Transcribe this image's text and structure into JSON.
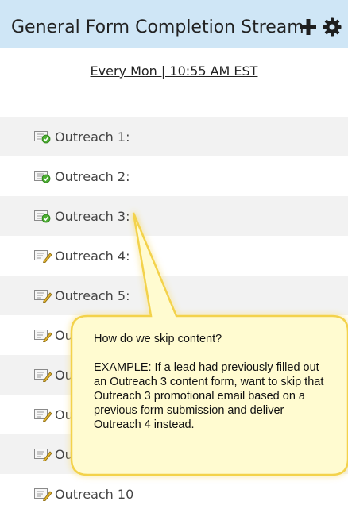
{
  "header": {
    "title": "General Form Completion Stream",
    "add_icon": "plus-icon",
    "settings_icon": "gear-icon",
    "color": "#cfe6f6"
  },
  "schedule": "Every Mon | 10:55 AM EST",
  "rows": [
    {
      "label": "Outreach 1:",
      "icon": "email-checked-icon"
    },
    {
      "label": "Outreach 2:",
      "icon": "email-checked-icon"
    },
    {
      "label": "Outreach 3:",
      "icon": "email-checked-icon"
    },
    {
      "label": "Outreach 4:",
      "icon": "email-edit-icon"
    },
    {
      "label": "Outreach 5:",
      "icon": "email-edit-icon"
    },
    {
      "label": "Out",
      "icon": "email-edit-icon"
    },
    {
      "label": "Ou",
      "icon": "email-edit-icon"
    },
    {
      "label": "Ou",
      "icon": "email-edit-icon"
    },
    {
      "label": "Ou",
      "icon": "email-edit-icon"
    },
    {
      "label": "Outreach 10",
      "icon": "email-edit-icon"
    }
  ],
  "callout": {
    "question": "How do we skip content?",
    "example": "EXAMPLE: If a lead had previously filled out an Outreach 3 content form, want to skip that Outreach 3 promotional email based on a previous form submission and deliver Outreach 4 instead.",
    "fill_color": "#fffbd0",
    "border_color": "#f3d24c"
  }
}
